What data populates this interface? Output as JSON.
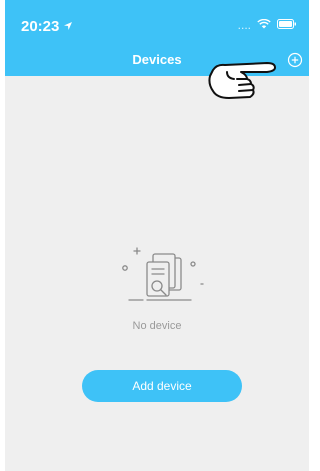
{
  "status": {
    "time": "20:23",
    "signal_dots": "...."
  },
  "nav": {
    "title": "Devices",
    "add_icon": "plus-circle-icon"
  },
  "empty": {
    "message": "No device",
    "icon": "document-search-icon"
  },
  "actions": {
    "add_device_label": "Add device"
  },
  "colors": {
    "accent": "#3ec2f7",
    "background": "#efefef",
    "text_muted": "#9a9a9a"
  }
}
